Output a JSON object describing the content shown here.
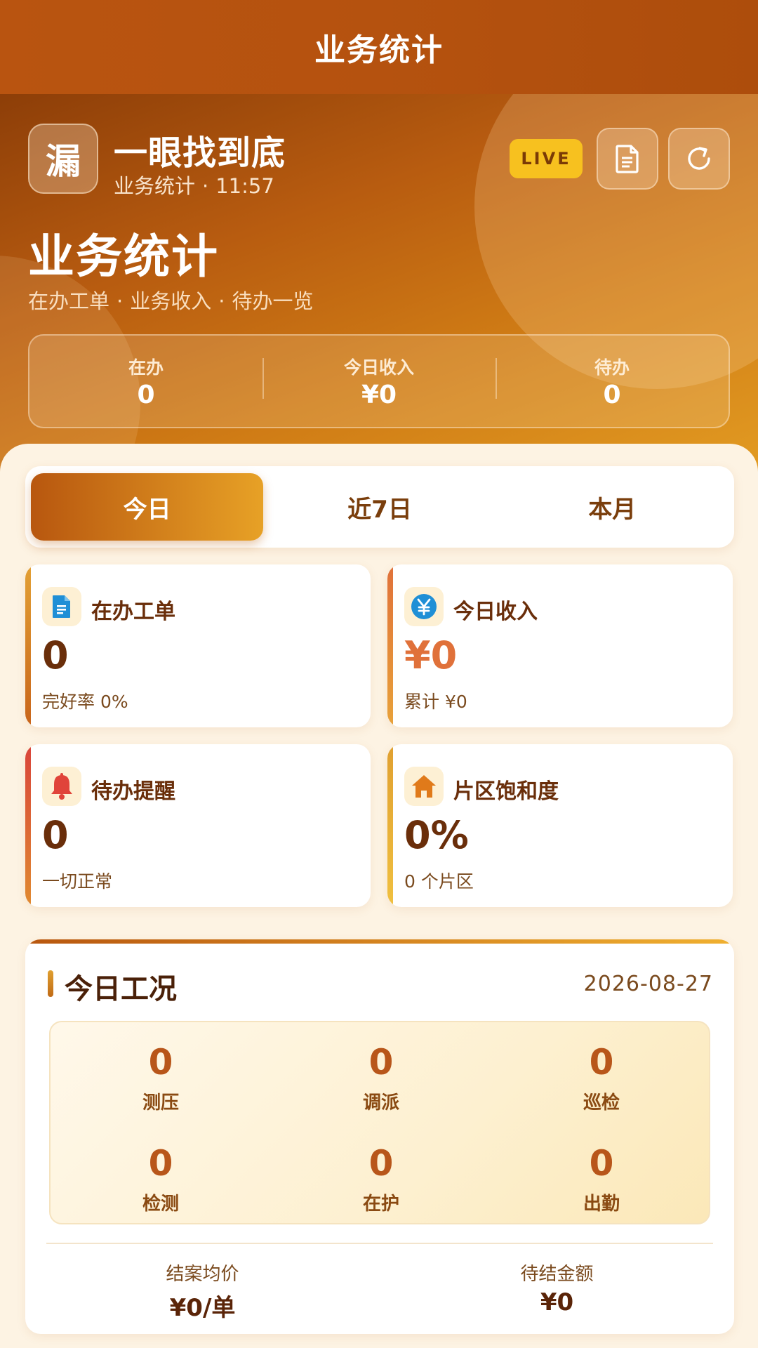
{
  "appbar": {
    "title": "业务统计"
  },
  "brand": {
    "logo_char": "漏",
    "name": "一眼找到底",
    "sub_label": "业务统计",
    "sub_sep": "·",
    "time": "11:57"
  },
  "header_actions": {
    "live_label": "LIVE",
    "doc_icon": "document-icon",
    "refresh_icon": "refresh-icon"
  },
  "hero": {
    "title": "业务统计",
    "subtitle_items": [
      "在办工单",
      "业务收入",
      "待办一览"
    ],
    "sep": "·",
    "stats": [
      {
        "label": "在办",
        "value": "0"
      },
      {
        "label": "今日收入",
        "value": "¥0"
      },
      {
        "label": "待办",
        "value": "0"
      }
    ]
  },
  "tabs": {
    "items": [
      "今日",
      "近7日",
      "本月"
    ],
    "active_index": 0
  },
  "cards": [
    {
      "title": "在办工单",
      "value": "0",
      "sub": "完好率 0%",
      "icon": "document-icon",
      "icon_color": "#1f8fd6",
      "edge_color": "#e08a2a"
    },
    {
      "title": "今日收入",
      "value": "¥0",
      "sub": "累计 ¥0",
      "icon": "yuan-icon",
      "icon_color": "#1f8fd6",
      "edge_color": "#e0713a"
    },
    {
      "title": "待办提醒",
      "value": "0",
      "sub": "一切正常",
      "icon": "bell-icon",
      "icon_color": "#e0443a",
      "edge_color": "#d94a3a"
    },
    {
      "title": "片区饱和度",
      "value": "0%",
      "sub": "0 个片区",
      "icon": "home-icon",
      "icon_color": "#e07a1a",
      "edge_color": "#e0a030"
    }
  ],
  "work_status": {
    "title": "今日工况",
    "date": "2026-08-27",
    "metrics": [
      {
        "label": "测压",
        "value": "0"
      },
      {
        "label": "调派",
        "value": "0"
      },
      {
        "label": "巡检",
        "value": "0"
      },
      {
        "label": "检测",
        "value": "0"
      },
      {
        "label": "在护",
        "value": "0"
      },
      {
        "label": "出勤",
        "value": "0"
      }
    ],
    "footer": [
      {
        "label": "结案均价",
        "value": "¥0/单"
      },
      {
        "label": "待结金额",
        "value": "¥0"
      }
    ]
  },
  "colors": {
    "accent": "#b8570f",
    "accent_light": "#e7a126",
    "live": "#f7c11f",
    "text_dark": "#6a2e0a",
    "orange_value": "#e0713a"
  }
}
